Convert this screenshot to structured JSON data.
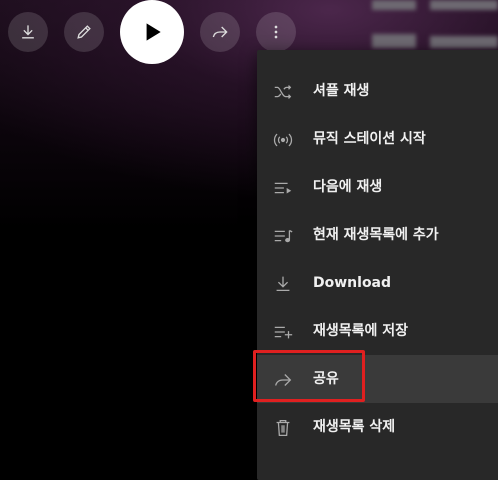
{
  "menu": {
    "items": [
      {
        "label": "셔플 재생",
        "icon": "shuffle-icon"
      },
      {
        "label": "뮤직 스테이션 시작",
        "icon": "radio-icon"
      },
      {
        "label": "다음에 재생",
        "icon": "play-next-icon"
      },
      {
        "label": "현재 재생목록에 추가",
        "icon": "add-to-queue-icon"
      },
      {
        "label": "Download",
        "icon": "download-icon"
      },
      {
        "label": "재생목록에 저장",
        "icon": "playlist-add-icon"
      },
      {
        "label": "공유",
        "icon": "share-icon"
      },
      {
        "label": "재생목록 삭제",
        "icon": "trash-icon"
      }
    ],
    "highlighted_item": "공유"
  },
  "top_controls": [
    "download-icon",
    "edit-icon",
    "play-icon",
    "share-icon",
    "more-vert-icon"
  ],
  "colors": {
    "menu_bg": "#282828",
    "menu_hover": "#3a3a3a",
    "highlight": "#e02020",
    "text": "#f1f1f1",
    "icon": "#aaaaaa"
  }
}
